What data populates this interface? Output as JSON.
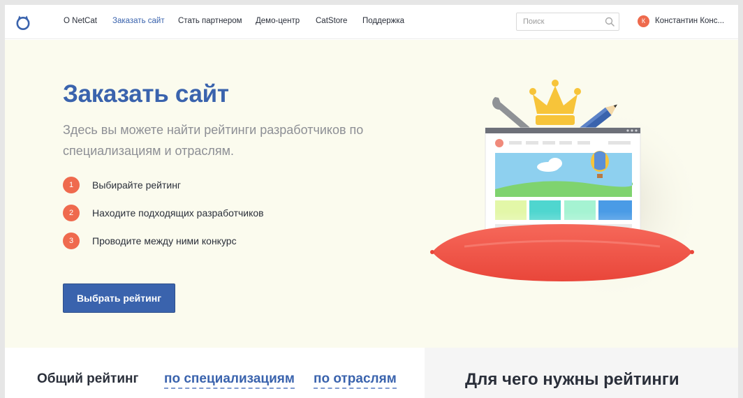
{
  "header": {
    "nav": [
      {
        "label": "О NetCat",
        "active": false
      },
      {
        "label": "Заказать сайт",
        "active": true
      },
      {
        "label": "Стать партнером",
        "active": false
      },
      {
        "label": "Демо-центр",
        "active": false
      },
      {
        "label": "CatStore",
        "active": false
      },
      {
        "label": "Поддержка",
        "active": false
      }
    ],
    "search": {
      "placeholder": "Поиск",
      "value": ""
    },
    "user": {
      "initial": "К",
      "name": "Константин Конс..."
    }
  },
  "hero": {
    "title": "Заказать сайт",
    "subtitle": "Здесь вы можете найти рейтинги разработчиков по специализациям и отраслям.",
    "steps": [
      {
        "num": "1",
        "text": "Выбирайте рейтинг"
      },
      {
        "num": "2",
        "text": "Находите подходящих разработчиков"
      },
      {
        "num": "3",
        "text": "Проводите между ними конкурс"
      }
    ],
    "cta_label": "Выбрать рейтинг"
  },
  "ratings": {
    "tabs": [
      "Общий рейтинг",
      "по специализациям",
      "по отраслям"
    ]
  },
  "why": {
    "title": "Для чего нужны рейтинги"
  },
  "colors": {
    "accent": "#3a63ad",
    "step_badge": "#ef6a4e",
    "hero_bg": "#fbfbee",
    "pillow": "#f1574a"
  },
  "icons": [
    "netcat-cat-logo-icon",
    "search-icon",
    "crown-icon",
    "wrench-icon",
    "pencil-icon",
    "balloon-icon",
    "cloud-icon"
  ]
}
